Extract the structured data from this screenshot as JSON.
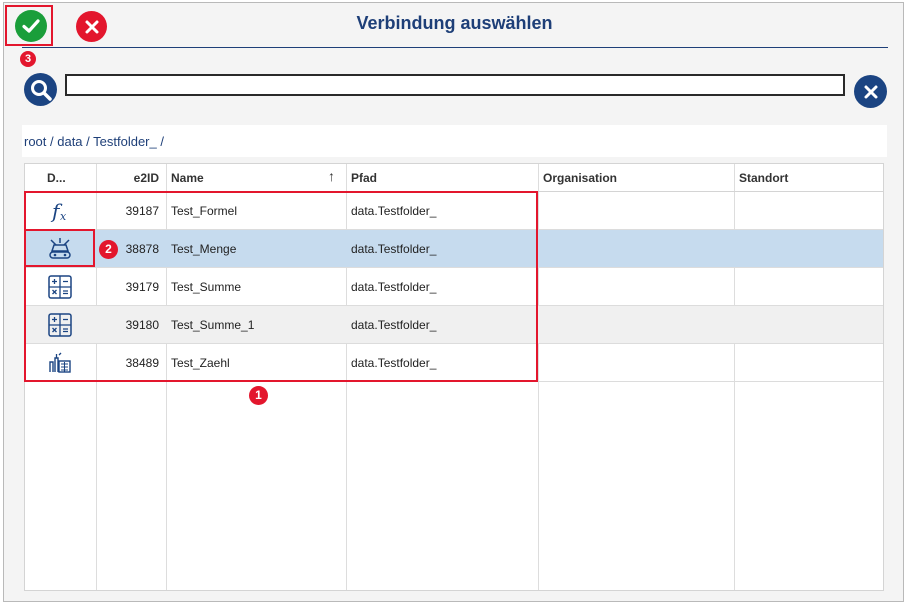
{
  "dialog": {
    "title": "Verbindung auswählen"
  },
  "toolbar": {
    "ok_icon": "checkmark-icon",
    "cancel_icon": "close-icon"
  },
  "search": {
    "value": "",
    "placeholder": "",
    "search_icon": "search-icon",
    "clear_icon": "clear-icon"
  },
  "breadcrumb": {
    "text": "root / data / Testfolder_ /"
  },
  "table": {
    "columns": [
      "D...",
      "e2ID",
      "Name",
      "Pfad",
      "Organisation",
      "Standort"
    ],
    "sort_indicator": "↑",
    "rows": [
      {
        "icon": "formula-icon",
        "id": "39187",
        "name": "Test_Formel",
        "path": "data.Testfolder_",
        "org": "",
        "site": ""
      },
      {
        "icon": "quantity-icon",
        "id": "38878",
        "name": "Test_Menge",
        "path": "data.Testfolder_",
        "org": "",
        "site": ""
      },
      {
        "icon": "calculator-icon",
        "id": "39179",
        "name": "Test_Summe",
        "path": "data.Testfolder_",
        "org": "",
        "site": ""
      },
      {
        "icon": "calculator-icon",
        "id": "39180",
        "name": "Test_Summe_1",
        "path": "data.Testfolder_",
        "org": "",
        "site": ""
      },
      {
        "icon": "counter-icon",
        "id": "38489",
        "name": "Test_Zaehl",
        "path": "data.Testfolder_",
        "org": "",
        "site": ""
      }
    ]
  },
  "annotations": {
    "badge1": "1",
    "badge2": "2",
    "badge3": "3"
  },
  "colors": {
    "accent": "#1e3f78",
    "ok": "#1a9e3a",
    "cancel": "#e3162d",
    "selected_row": "#c6dbee",
    "annotation": "#e3162d"
  }
}
